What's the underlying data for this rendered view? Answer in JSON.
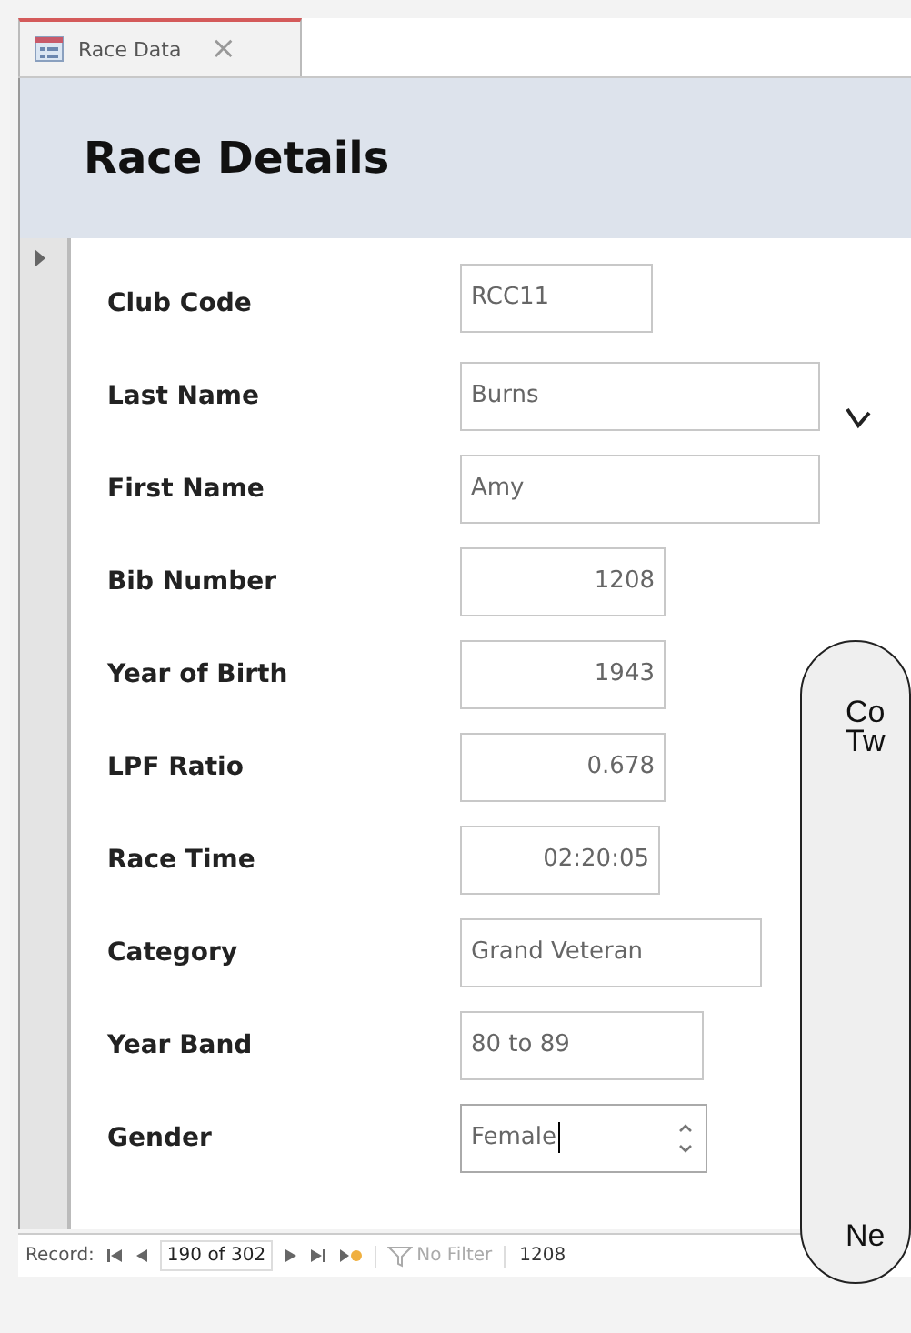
{
  "tab": {
    "title": "Race Data",
    "selected": true,
    "close": "×"
  },
  "form_header": {
    "title": "Race Details"
  },
  "fields": [
    {
      "label": "Club Code",
      "value": "RCC11",
      "kind": "text",
      "focused": false
    },
    {
      "label": "Last Name",
      "value": "Burns",
      "kind": "text",
      "focused": false
    },
    {
      "label": "First Name",
      "value": "Amy",
      "kind": "text",
      "focused": false
    },
    {
      "label": "Bib Number",
      "value": "1208",
      "kind": "number",
      "focused": false
    },
    {
      "label": "Year of Birth",
      "value": "1943",
      "kind": "number",
      "focused": false
    },
    {
      "label": "LPF Ratio",
      "value": "0.678",
      "kind": "number",
      "focused": false
    },
    {
      "label": "Race Time",
      "value": "02:20:05",
      "kind": "number",
      "focused": false
    },
    {
      "label": "Category",
      "value": "Grand Veteran",
      "kind": "text",
      "focused": false
    },
    {
      "label": "Year Band",
      "value": "80 to 89",
      "kind": "text",
      "focused": false
    },
    {
      "label": "Gender",
      "value": "Female",
      "kind": "spinner",
      "focused": true
    }
  ],
  "callout": {
    "lines": [
      "Co",
      "Tw",
      "Ne"
    ]
  },
  "navigation": {
    "label": "Record:",
    "position": "190 of 302",
    "filter": "No Filter",
    "search": "1208"
  }
}
